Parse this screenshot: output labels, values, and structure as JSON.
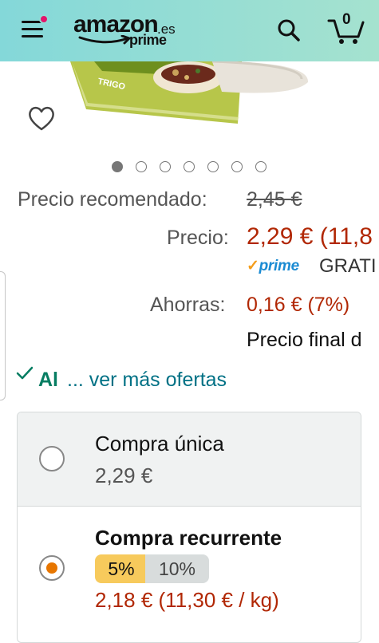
{
  "header": {
    "logo_word": "amazon",
    "logo_suffix": ".es",
    "logo_sub": "prime",
    "cart_count": "0"
  },
  "product": {
    "package_text": "TRIGO"
  },
  "gallery": {
    "image_count": 7,
    "active_index": 0
  },
  "pricing": {
    "list_label": "Precio recomendado:",
    "list_price": "2,45 €",
    "price_label": "Precio:",
    "price": "2,29 € (11,8",
    "prime_word": "prime",
    "prime_shipping": "GRATI",
    "savings_label": "Ahorras:",
    "savings": "0,16 € (7%)",
    "final_note": "Precio final d"
  },
  "availability": {
    "stock_text": "Al",
    "more_offers": "... ver más ofertas"
  },
  "purchase_options": {
    "once_title": "Compra única",
    "once_price": "2,29 €",
    "recurring_title": "Compra recurrente",
    "discount_selected": "5%",
    "discount_other": "10%",
    "recurring_price": "2,18 € (11,30 € / kg)"
  },
  "colors": {
    "header_start": "#84d8d9",
    "price_red": "#b12704",
    "link_teal": "#007185",
    "stock_green": "#067d62",
    "radio_orange": "#e77600"
  }
}
